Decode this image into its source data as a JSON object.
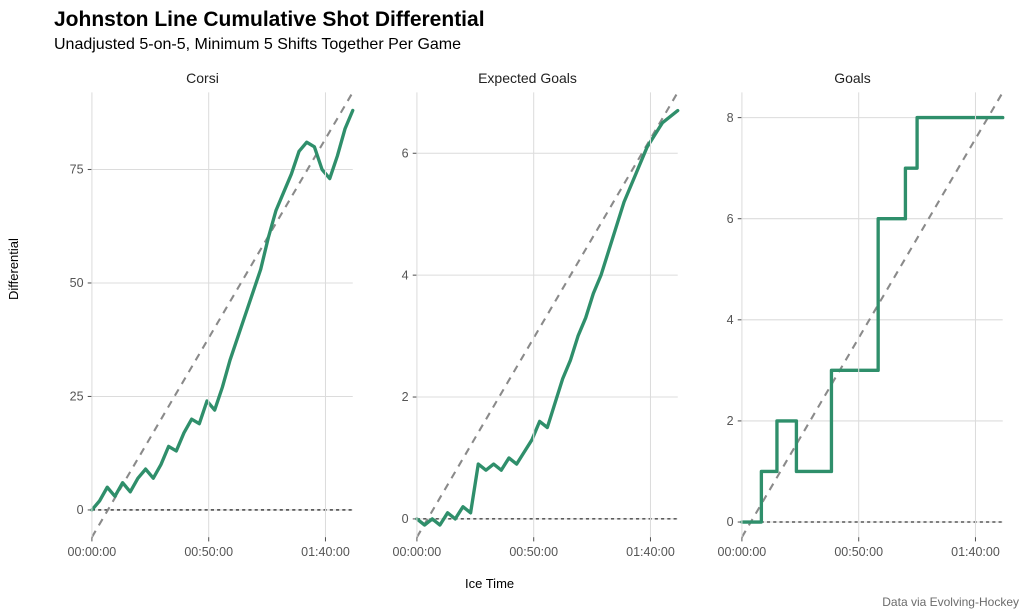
{
  "title": "Johnston Line Cumulative Shot Differential",
  "subtitle": "Unadjusted 5-on-5, Minimum 5 Shifts Together Per Game",
  "ylabel": "Differential",
  "xlabel": "Ice Time",
  "caption": "Data via Evolving-Hockey",
  "colors": {
    "line": "#2F8F6B",
    "trend": "#8a8a8a",
    "zero": "#000"
  },
  "x_ticks": [
    "00:00:00",
    "00:50:00",
    "01:40:00"
  ],
  "x_domain_seconds": [
    0,
    6700
  ],
  "chart_data": [
    {
      "type": "line",
      "facet": "Corsi",
      "y_ticks": [
        0,
        25,
        50,
        75
      ],
      "ylim": [
        -6,
        92
      ],
      "trend": {
        "x0": 0,
        "y0": -6,
        "x1": 6700,
        "y1": 92
      },
      "x": [
        0,
        200,
        400,
        600,
        800,
        1000,
        1200,
        1400,
        1600,
        1800,
        2000,
        2200,
        2400,
        2600,
        2800,
        3000,
        3200,
        3400,
        3600,
        3800,
        4000,
        4200,
        4400,
        4600,
        4800,
        5000,
        5200,
        5400,
        5600,
        5800,
        6000,
        6200,
        6400,
        6600
      ],
      "values": [
        0,
        2,
        5,
        3,
        6,
        4,
        7,
        9,
        7,
        10,
        14,
        13,
        17,
        20,
        19,
        24,
        22,
        27,
        33,
        38,
        43,
        48,
        53,
        60,
        66,
        70,
        74,
        79,
        81,
        80,
        75,
        73,
        78,
        84,
        88
      ]
    },
    {
      "type": "line",
      "facet": "Expected Goals",
      "y_ticks": [
        0,
        2,
        4,
        6
      ],
      "ylim": [
        -0.3,
        7.0
      ],
      "trend": {
        "x0": 0,
        "y0": -0.3,
        "x1": 6700,
        "y1": 7.0
      },
      "x": [
        0,
        200,
        400,
        600,
        800,
        1000,
        1200,
        1400,
        1600,
        1800,
        2000,
        2200,
        2400,
        2600,
        2800,
        3000,
        3200,
        3400,
        3600,
        3800,
        4000,
        4200,
        4400,
        4600,
        4800,
        5000,
        5200,
        5400,
        5600,
        5800,
        6000,
        6200,
        6400,
        6600
      ],
      "values": [
        0.0,
        -0.1,
        0.0,
        -0.1,
        0.1,
        0.0,
        0.2,
        0.1,
        0.9,
        0.8,
        0.9,
        0.8,
        1.0,
        0.9,
        1.1,
        1.3,
        1.6,
        1.5,
        1.9,
        2.3,
        2.6,
        3.0,
        3.3,
        3.7,
        4.0,
        4.4,
        4.8,
        5.2,
        5.5,
        5.8,
        6.1,
        6.3,
        6.5,
        6.6,
        6.7
      ]
    },
    {
      "type": "line",
      "facet": "Goals",
      "y_ticks": [
        0,
        2,
        4,
        6,
        8
      ],
      "ylim": [
        -0.3,
        8.5
      ],
      "trend": {
        "x0": 0,
        "y0": -0.3,
        "x1": 6700,
        "y1": 8.5
      },
      "step": true,
      "x": [
        0,
        300,
        500,
        700,
        900,
        1100,
        1400,
        1700,
        2300,
        2700,
        3100,
        3500,
        3900,
        4200,
        4500,
        6400,
        6700
      ],
      "values": [
        0,
        0,
        1,
        1,
        2,
        2,
        1,
        1,
        3,
        3,
        3,
        6,
        6,
        7,
        8,
        8,
        8
      ]
    }
  ]
}
